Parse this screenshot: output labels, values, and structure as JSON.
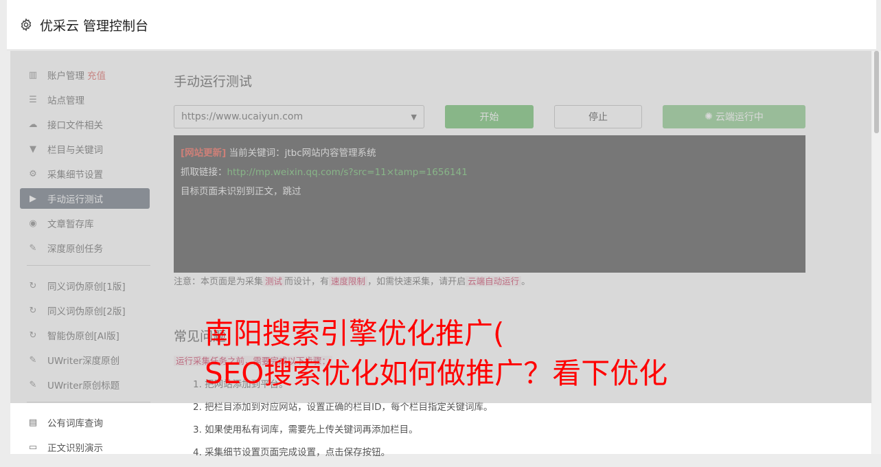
{
  "header": {
    "title": "优采云 管理控制台",
    "icon": "gear-icon"
  },
  "sidebar": {
    "items": [
      {
        "label": "账户管理",
        "badge": "充值",
        "icon": "bar-chart-icon"
      },
      {
        "label": "站点管理",
        "icon": "list-icon"
      },
      {
        "label": "接口文件相关",
        "icon": "cloud-upload-icon"
      },
      {
        "label": "栏目与关键词",
        "icon": "filter-icon"
      },
      {
        "label": "采集细节设置",
        "icon": "cogs-icon"
      },
      {
        "label": "手动运行测试",
        "icon": "play-icon",
        "active": true
      },
      {
        "label": "文章暂存库",
        "icon": "database-icon"
      },
      {
        "label": "深度原创任务",
        "icon": "edit-icon"
      },
      {
        "label": "同义词伪原创[1版]",
        "icon": "refresh-icon"
      },
      {
        "label": "同义词伪原创[2版]",
        "icon": "refresh-icon"
      },
      {
        "label": "智能伪原创[AI版]",
        "icon": "refresh-icon"
      },
      {
        "label": "UWriter深度原创",
        "icon": "edit-icon"
      },
      {
        "label": "UWriter原创标题",
        "icon": "edit-icon"
      },
      {
        "label": "公有词库查询",
        "icon": "book-icon"
      },
      {
        "label": "正文识别演示",
        "icon": "monitor-icon"
      }
    ]
  },
  "main": {
    "title": "手动运行测试",
    "site_select": "https://www.ucaiyun.com",
    "start_label": "开始",
    "stop_label": "停止",
    "cloud_label": "云端运行中",
    "console": {
      "tag": "[网站更新]",
      "line1": "当前关键词：jtbc网站内容管理系统",
      "line2_label": "抓取链接：",
      "line2_link": "http://mp.weixin.qq.com/s?src=11×tamp=1656141",
      "line3": "目标页面未识别到正文，跳过"
    },
    "note": {
      "prefix": "注意：本页面是为采集",
      "code1": "测试",
      "mid1": "而设计，有",
      "code2": "速度限制",
      "mid2": "，如需快速采集，请开启",
      "code3": "云端自动运行",
      "suffix": "。"
    },
    "faq_title": "常见问题",
    "faq_sub": "运行采集任务之前，需要完成以下步骤：",
    "faq_items": [
      "1. 把网站添加到平台。",
      "2. 把栏目添加到对应网站，设置正确的栏目ID，每个栏目指定关键词库。",
      "3. 如果使用私有词库，需要先上传关键词再添加栏目。",
      "4. 采集细节设置页面完成设置，点击保存按钮。"
    ]
  },
  "watermark": {
    "line1": "南阳搜索引擎优化推广(",
    "line2": "SEO搜索优化如何做推广？看下优化"
  },
  "colors": {
    "primary": "#5cb85c",
    "active_nav": "#5a6573",
    "accent_red": "#d9534f",
    "watermark": "#ff0000"
  }
}
